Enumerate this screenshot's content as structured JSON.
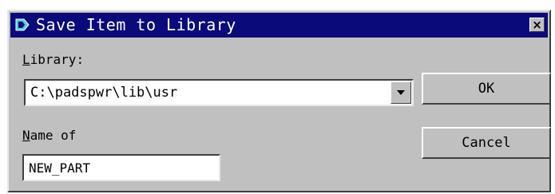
{
  "dialog": {
    "title": "Save Item to Library",
    "close_glyph": "×",
    "title_icon": "app-logo-icon"
  },
  "library": {
    "label_accel": "L",
    "label_rest": "ibrary:",
    "value": "C:\\padspwr\\lib\\usr",
    "dropdown_icon": "chevron-down-icon"
  },
  "name": {
    "label_accel": "N",
    "label_rest": "ame of",
    "value": "NEW_PART"
  },
  "buttons": {
    "ok": "OK",
    "cancel": "Cancel"
  },
  "colors": {
    "titlebar": "#0a0a7a",
    "face": "#c0c0c0",
    "field": "#ffffff"
  }
}
